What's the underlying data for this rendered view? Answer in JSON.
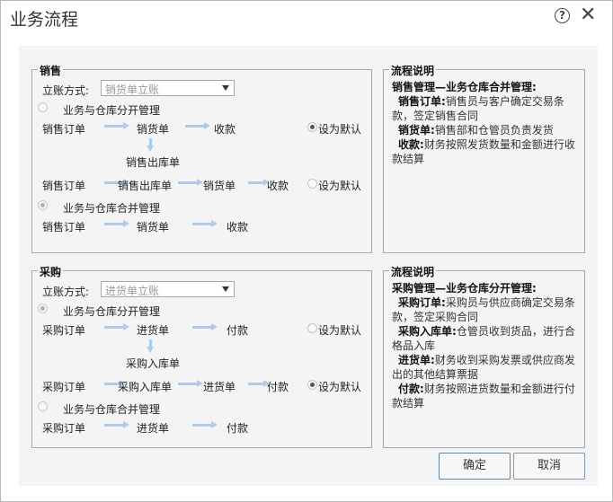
{
  "dialog": {
    "title": "业务流程",
    "help_label": "?",
    "close_label": "✕",
    "confirm_label": "确定",
    "cancel_label": "取消"
  },
  "sales": {
    "title": "销售",
    "account_label": "立账方式:",
    "account_value": "销货单立账",
    "separate_mode": "业务与仓库分开管理",
    "merged_mode": "业务与仓库合并管理",
    "flow1": [
      "销售订单",
      "销货单",
      "收款"
    ],
    "flow1_sub": "销售出库单",
    "flow2": [
      "销售订单",
      "销售出库单",
      "销货单",
      "收款"
    ],
    "flow3": [
      "销售订单",
      "销货单",
      "收款"
    ],
    "set_default": "设为默认",
    "desc_title": "流程说明",
    "desc_heading": "销售管理—业务仓库合并管理:",
    "desc_items": [
      {
        "term": "销售订单:",
        "text": "销售员与客户确定交易条款，签定销售合同"
      },
      {
        "term": "销货单:",
        "text": "销售部和仓管员负责发货"
      },
      {
        "term": "收款:",
        "text": "财务按照发货数量和金额进行收款结算"
      }
    ]
  },
  "purchase": {
    "title": "采购",
    "account_label": "立账方式:",
    "account_value": "进货单立账",
    "separate_mode": "业务与仓库分开管理",
    "merged_mode": "业务与仓库合并管理",
    "flow1": [
      "采购订单",
      "进货单",
      "付款"
    ],
    "flow1_sub": "采购入库单",
    "flow2": [
      "采购订单",
      "采购入库单",
      "进货单",
      "付款"
    ],
    "flow3": [
      "采购订单",
      "进货单",
      "付款"
    ],
    "set_default": "设为默认",
    "desc_title": "流程说明",
    "desc_heading": "采购管理—业务仓库分开管理:",
    "desc_items": [
      {
        "term": "采购订单:",
        "text": "采购员与供应商确定交易条款，签定采购合同"
      },
      {
        "term": "采购入库单:",
        "text": "仓管员收到货品，进行合格品入库"
      },
      {
        "term": "进货单:",
        "text": "财务收到采购发票或供应商发出的其他结算票据"
      },
      {
        "term": "付款:",
        "text": "财务按照进货数量和金额进行付款结算"
      }
    ]
  }
}
